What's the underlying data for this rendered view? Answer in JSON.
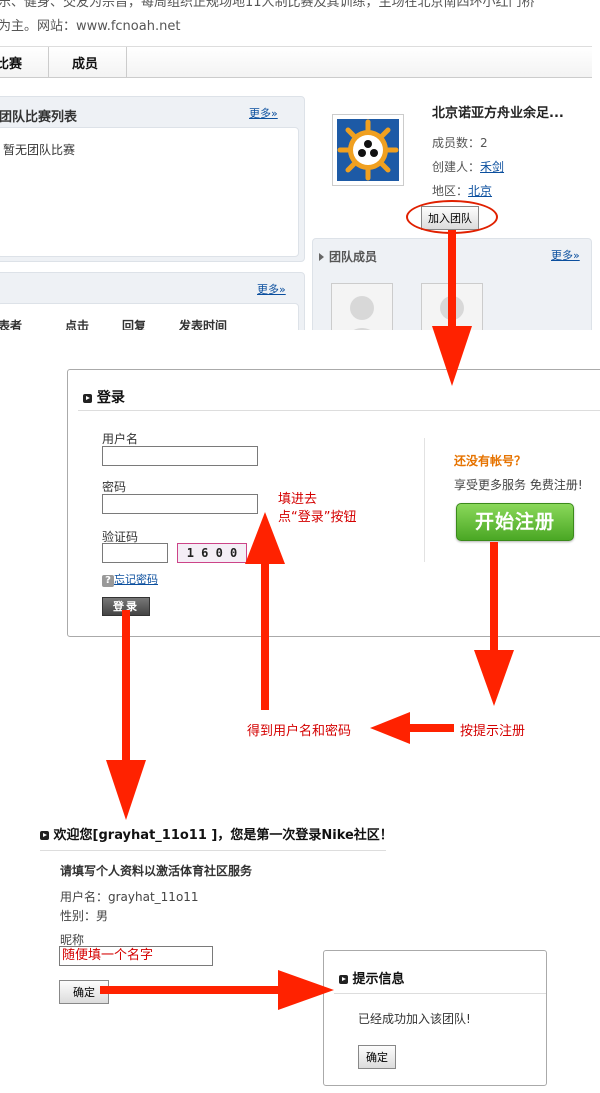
{
  "top": {
    "desc_line1": "乐、健身、交友为宗旨，每周组织正规场地11人制比赛及其训练，主场在北京南四环小红门桥",
    "desc_line2": "为主。网站：www.fcnoah.net"
  },
  "tabs": [
    {
      "label": "比赛"
    },
    {
      "label": "成员"
    }
  ],
  "match_panel": {
    "title": "团队比赛列表",
    "more": "更多»",
    "empty": "暂无团队比赛"
  },
  "topic_panel": {
    "more": "更多»",
    "columns": [
      "表者",
      "点击",
      "回复",
      "发表时间"
    ]
  },
  "team": {
    "name": "北京诺亚方舟业余足...",
    "member_count_label": "成员数：2",
    "creator_label": "创建人：",
    "creator_name": "禾剑",
    "region_label": "地区：",
    "region_name": "北京",
    "join_button": "加入团队"
  },
  "members_panel": {
    "title": "团队成员",
    "more": "更多»"
  },
  "login": {
    "title": "登录",
    "username_label": "用户名",
    "password_label": "密码",
    "captcha_label": "验证码",
    "captcha_text": "1 6 0 0",
    "forgot": "忘记密码",
    "submit": "登录",
    "no_account": "还没有帐号？",
    "enjoy": "享受更多服务 免费注册!",
    "register": "开始注册"
  },
  "annotations": {
    "fill_line1": "填进去",
    "fill_line2": "点“登录”按钮",
    "get_credentials": "得到用户名和密码",
    "follow_register": "按提示注册"
  },
  "welcome": {
    "title": "欢迎您[grayhat_11o11 ]，您是第一次登录Nike社区！",
    "subtitle": "请填写个人资料以激活体育社区服务",
    "username": "用户名：grayhat_11o11",
    "gender": "性别：男",
    "nickname_label": "昵称",
    "nickname_value": "随便填一个名字",
    "confirm": "确定"
  },
  "info": {
    "title": "提示信息",
    "message": "已经成功加入该团队!",
    "confirm": "确定"
  },
  "colors": {
    "arrow": "#ff2200",
    "register_green": "#5cb82e",
    "link": "#0b4f9e",
    "annotation": "#d40000"
  }
}
